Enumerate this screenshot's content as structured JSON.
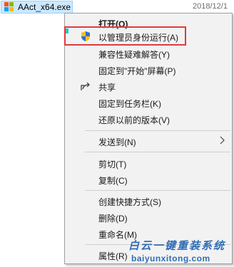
{
  "file": {
    "name": "AAct_x64.exe",
    "date": "2018/12/1"
  },
  "menu": {
    "items": [
      {
        "label": "打开(O)"
      },
      {
        "label": "以管理员身份运行(A)"
      },
      {
        "label": "兼容性疑难解答(Y)"
      },
      {
        "label": "固定到\"开始\"屏幕(P)"
      },
      {
        "label": "共享"
      },
      {
        "label": "固定到任务栏(K)"
      },
      {
        "label": "还原以前的版本(V)"
      },
      {
        "label": "发送到(N)"
      },
      {
        "label": "剪切(T)"
      },
      {
        "label": "复制(C)"
      },
      {
        "label": "创建快捷方式(S)"
      },
      {
        "label": "删除(D)"
      },
      {
        "label": "重命名(M)"
      },
      {
        "label": "属性(R)"
      }
    ]
  },
  "watermark": {
    "title": "白云一键重装系统",
    "url": "baiyunxitong.com"
  },
  "colors": {
    "highlight_border": "#e03b3b",
    "selection": "#cce8ff",
    "watermark": "#2f6db5"
  },
  "icons": {
    "file": "windows-app-icon",
    "run_as_admin": "uac-shield-icon",
    "share": "share-icon",
    "send_to": "chevron-right-icon"
  }
}
